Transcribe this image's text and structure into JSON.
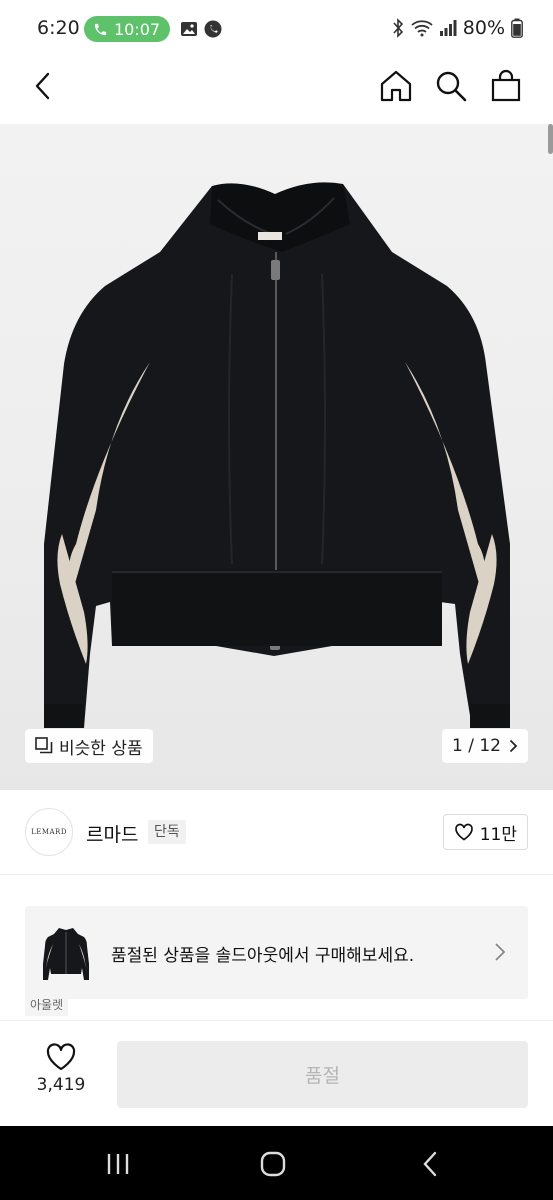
{
  "status_bar": {
    "time": "6:20",
    "call_time": "10:07",
    "battery": "80%"
  },
  "header": {
    "back_icon": "chevron-left-icon",
    "home_icon": "home-icon",
    "search_icon": "search-icon",
    "cart_icon": "shopping-bag-icon"
  },
  "gallery": {
    "similar_label": "비슷한 상품",
    "counter": "1 / 12"
  },
  "brand": {
    "logo_text": "LEMARD",
    "name": "르마드",
    "tag": "단독",
    "wish_count": "11만"
  },
  "banner": {
    "text": "품절된 상품을 솔드아웃에서 구매해보세요."
  },
  "cut_tag": "아울렛",
  "action_bar": {
    "like_count": "3,419",
    "buy_label": "품절"
  },
  "colors": {
    "call_pill": "#5ec26a",
    "jacket_body": "#15171a",
    "jacket_panel": "#d9d2c5",
    "disabled_button": "#ececec"
  }
}
